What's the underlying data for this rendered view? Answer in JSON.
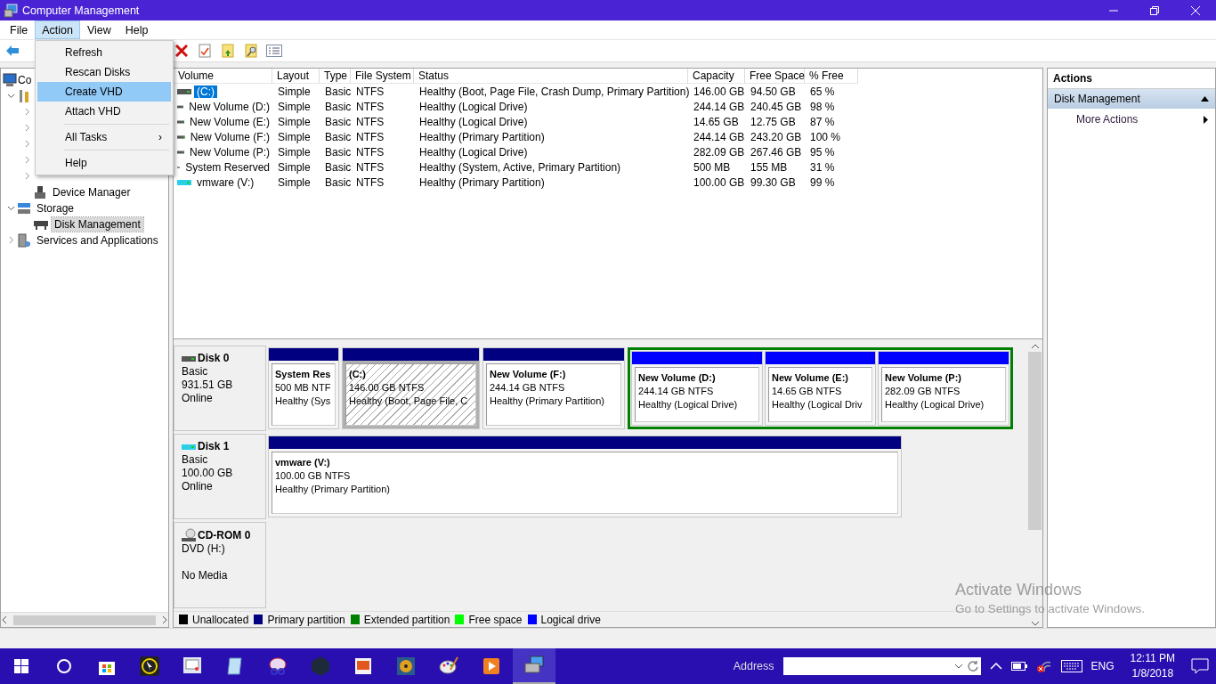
{
  "window": {
    "title": "Computer Management"
  },
  "menu_bar": [
    {
      "label": "File",
      "selected": false
    },
    {
      "label": "Action",
      "selected": true
    },
    {
      "label": "View",
      "selected": false
    },
    {
      "label": "Help",
      "selected": false
    }
  ],
  "action_menu": [
    {
      "kind": "item",
      "label": "Refresh",
      "selected": false
    },
    {
      "kind": "item",
      "label": "Rescan Disks",
      "selected": false
    },
    {
      "kind": "item",
      "label": "Create VHD",
      "selected": true
    },
    {
      "kind": "item",
      "label": "Attach VHD",
      "selected": false
    },
    {
      "kind": "separator"
    },
    {
      "kind": "submenu",
      "label": "All Tasks",
      "arrow": "›",
      "selected": false
    },
    {
      "kind": "separator"
    },
    {
      "kind": "item",
      "label": "Help",
      "selected": false
    }
  ],
  "tree": [
    {
      "kind": "computer",
      "label": "Co",
      "selected": false,
      "children": [
        {
          "kind": "tools",
          "expanded": true,
          "children": [
            {
              "kind": "tool",
              "expanded": false
            },
            {
              "kind": "tool",
              "expanded": false
            },
            {
              "kind": "tool",
              "expanded": false
            },
            {
              "kind": "tool",
              "expanded": false
            },
            {
              "kind": "tool",
              "expanded": false
            },
            {
              "kind": "device",
              "label": "Device Manager",
              "selected": false
            }
          ]
        },
        {
          "kind": "storage",
          "label": "Storage",
          "expanded": true,
          "selected": false,
          "children": [
            {
              "kind": "disk",
              "label": "Disk Management",
              "selected": true
            }
          ]
        },
        {
          "kind": "services",
          "label": "Services and Applications",
          "expanded": false,
          "selected": false
        }
      ]
    }
  ],
  "volume_table": {
    "columns": [
      "Volume",
      "Layout",
      "Type",
      "File System",
      "Status",
      "Capacity",
      "Free Space",
      "% Free"
    ],
    "rows": [
      {
        "selected": true,
        "cells": [
          "(C:)",
          "Simple",
          "Basic",
          "NTFS",
          "Healthy (Boot, Page File, Crash Dump, Primary Partition)",
          "146.00 GB",
          "94.50 GB",
          "65 %"
        ]
      },
      {
        "selected": false,
        "cells": [
          "New Volume (D:)",
          "Simple",
          "Basic",
          "NTFS",
          "Healthy (Logical Drive)",
          "244.14 GB",
          "240.45 GB",
          "98 %"
        ]
      },
      {
        "selected": false,
        "cells": [
          "New Volume (E:)",
          "Simple",
          "Basic",
          "NTFS",
          "Healthy (Logical Drive)",
          "14.65 GB",
          "12.75 GB",
          "87 %"
        ]
      },
      {
        "selected": false,
        "cells": [
          "New Volume (F:)",
          "Simple",
          "Basic",
          "NTFS",
          "Healthy (Primary Partition)",
          "244.14 GB",
          "243.20 GB",
          "100 %"
        ]
      },
      {
        "selected": false,
        "cells": [
          "New Volume (P:)",
          "Simple",
          "Basic",
          "NTFS",
          "Healthy (Logical Drive)",
          "282.09 GB",
          "267.46 GB",
          "95 %"
        ]
      },
      {
        "selected": false,
        "cells": [
          "System Reserved",
          "Simple",
          "Basic",
          "NTFS",
          "Healthy (System, Active, Primary Partition)",
          "500 MB",
          "155 MB",
          "31 %"
        ]
      },
      {
        "selected": false,
        "cells": [
          "vmware (V:)",
          "Simple",
          "Basic",
          "NTFS",
          "Healthy (Primary Partition)",
          "100.00 GB",
          "99.30 GB",
          "99 %"
        ]
      }
    ]
  },
  "disks": [
    {
      "kind": "disk",
      "name": "Disk 0",
      "lines": [
        "Basic",
        "931.51 GB",
        "Online"
      ],
      "partitions": [
        {
          "kind": "primary",
          "selected": false,
          "title": "System Res",
          "size": "500 MB NTF",
          "status": "Healthy (Sys"
        },
        {
          "kind": "primary",
          "selected": true,
          "title": "(C:)",
          "size": "146.00 GB NTFS",
          "status": "Healthy (Boot, Page File, C"
        },
        {
          "kind": "primary",
          "selected": false,
          "title": "New Volume  (F:)",
          "size": "244.14 GB NTFS",
          "status": "Healthy (Primary Partition)"
        },
        {
          "kind": "extended",
          "children": [
            {
              "kind": "logical",
              "selected": false,
              "title": "New Volume  (D:)",
              "size": "244.14 GB NTFS",
              "status": "Healthy (Logical Drive)"
            },
            {
              "kind": "logical",
              "selected": false,
              "title": "New Volume  (E:)",
              "size": "14.65 GB NTFS",
              "status": "Healthy (Logical Driv"
            },
            {
              "kind": "logical",
              "selected": false,
              "title": "New Volume  (P:)",
              "size": "282.09 GB NTFS",
              "status": "Healthy (Logical Drive)"
            }
          ]
        }
      ]
    },
    {
      "kind": "vdisk",
      "name": "Disk 1",
      "lines": [
        "Basic",
        "100.00 GB",
        "Online"
      ],
      "partitions": [
        {
          "kind": "primary",
          "selected": false,
          "title": "vmware  (V:)",
          "size": "100.00 GB NTFS",
          "status": "Healthy (Primary Partition)"
        }
      ]
    },
    {
      "kind": "cdrom",
      "name": "CD-ROM 0",
      "lines": [
        "DVD (H:)",
        "No Media"
      ]
    }
  ],
  "legend": [
    {
      "label": "Unallocated",
      "color": "#000000"
    },
    {
      "label": "Primary partition",
      "color": "#000080"
    },
    {
      "label": "Extended partition",
      "color": "#008000"
    },
    {
      "label": "Free space",
      "color": "#00ff00"
    },
    {
      "label": "Logical drive",
      "color": "#0000ff"
    }
  ],
  "actions_pane": {
    "title": "Actions",
    "section": "Disk Management",
    "items": [
      "More Actions"
    ]
  },
  "activation": {
    "title": "Activate Windows",
    "subtitle": "Go to Settings to activate Windows."
  },
  "taskbar": {
    "address_label": "Address",
    "language": "ENG",
    "time": "12:11 PM",
    "date": "1/8/2018"
  }
}
